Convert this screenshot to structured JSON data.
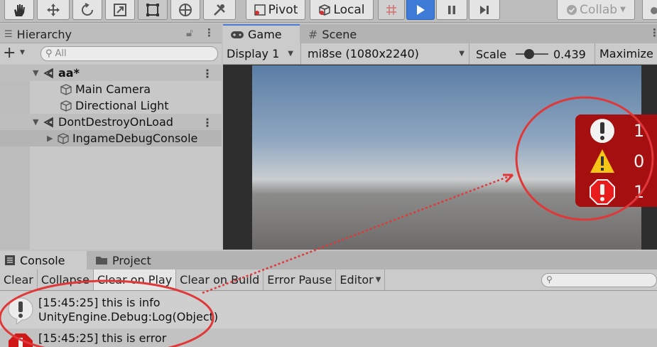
{
  "toolbar": {
    "pivot_label": "Pivot",
    "local_label": "Local",
    "collab_label": "Collab"
  },
  "hierarchy": {
    "tab_label": "Hierarchy",
    "search_placeholder": "All",
    "items": [
      {
        "label": "aa*",
        "type": "scene"
      },
      {
        "label": "Main Camera",
        "type": "object"
      },
      {
        "label": "Directional Light",
        "type": "object"
      },
      {
        "label": "DontDestroyOnLoad",
        "type": "scene"
      },
      {
        "label": "IngameDebugConsole",
        "type": "object"
      }
    ]
  },
  "game_view": {
    "tabs": [
      "Game",
      "Scene"
    ],
    "display_label": "Display 1",
    "resolution_label": "mi8se (1080x2240)",
    "scale_label": "Scale",
    "scale_value": "0.439",
    "maximize_label": "Maximize",
    "debug_popup": {
      "info_count": "1",
      "warning_count": "0",
      "error_count": "1",
      "colors": {
        "background": "#a60f0f",
        "warning": "#f5c518"
      }
    }
  },
  "console": {
    "tabs": [
      "Console",
      "Project"
    ],
    "buttons": [
      "Clear",
      "Collapse",
      "Clear on Play",
      "Clear on Build",
      "Error Pause",
      "Editor"
    ],
    "logs": [
      {
        "line1": "[15:45:25] this is info",
        "line2": "UnityEngine.Debug:Log(Object)",
        "level": "info"
      },
      {
        "line1": "[15:45:25] this is error",
        "level": "error"
      }
    ]
  },
  "annotation_color": "#e03838"
}
